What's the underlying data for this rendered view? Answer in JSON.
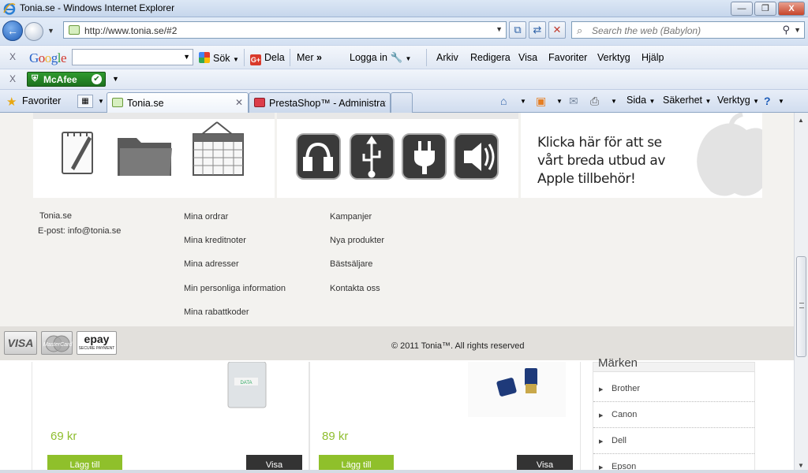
{
  "window": {
    "title": "Tonia.se - Windows Internet Explorer",
    "min": "—",
    "max": "❐",
    "close": "X"
  },
  "navigation": {
    "back": "←",
    "address": "http://www.tonia.se/#2",
    "search_placeholder": "Search the web (Babylon)"
  },
  "google_bar": {
    "close": "X",
    "logo_letters": [
      "G",
      "o",
      "o",
      "g",
      "l",
      "e"
    ],
    "logo_colors": [
      "#2a64c9",
      "#d4362b",
      "#f1b52a",
      "#2a64c9",
      "#36a244",
      "#d4362b"
    ],
    "sok": "Sök",
    "dela": "Dela",
    "dela_badge": "G+",
    "mer": "Mer",
    "logga_in": "Logga in",
    "menu": [
      "Arkiv",
      "Redigera",
      "Visa",
      "Favoriter",
      "Verktyg",
      "Hjälp"
    ]
  },
  "mcafee_bar": {
    "close": "X",
    "label": "McAfee",
    "check": "✔"
  },
  "tab_bar": {
    "favorites": "Favoriter",
    "tabs": [
      {
        "label": "Tonia.se",
        "active": true,
        "close": "✕"
      },
      {
        "label": "PrestaShop™ - Administrat...",
        "active": false
      }
    ],
    "commands": [
      "Sida",
      "Säkerhet",
      "Verktyg"
    ]
  },
  "banners": {
    "apple_lines": [
      "Klicka här för att se",
      "vårt breda utbud av",
      "Apple tillbehör!"
    ]
  },
  "footer": {
    "company": "Tonia.se",
    "email_label": "E-post:",
    "email": "info@tonia.se",
    "account_links": [
      "Mina ordrar",
      "Mina kreditnoter",
      "Mina adresser",
      "Min personliga information",
      "Mina rabattkoder"
    ],
    "shop_links": [
      "Kampanjer",
      "Nya produkter",
      "Bästsäljare",
      "Kontakta oss"
    ],
    "copyright": "© 2011 Tonia™. All rights reserved",
    "payment": {
      "visa": "VISA",
      "mastercard": "MasterCard",
      "epay": "epay",
      "epay_sub": "SECURE PAYMENT"
    }
  },
  "products": [
    {
      "price": "69 kr",
      "add": "Lägg till",
      "view": "Visa"
    },
    {
      "price": "89 kr",
      "add": "Lägg till",
      "view": "Visa"
    }
  ],
  "brands": {
    "heading": "Märken",
    "items": [
      "Brother",
      "Canon",
      "Dell",
      "Epson"
    ]
  }
}
